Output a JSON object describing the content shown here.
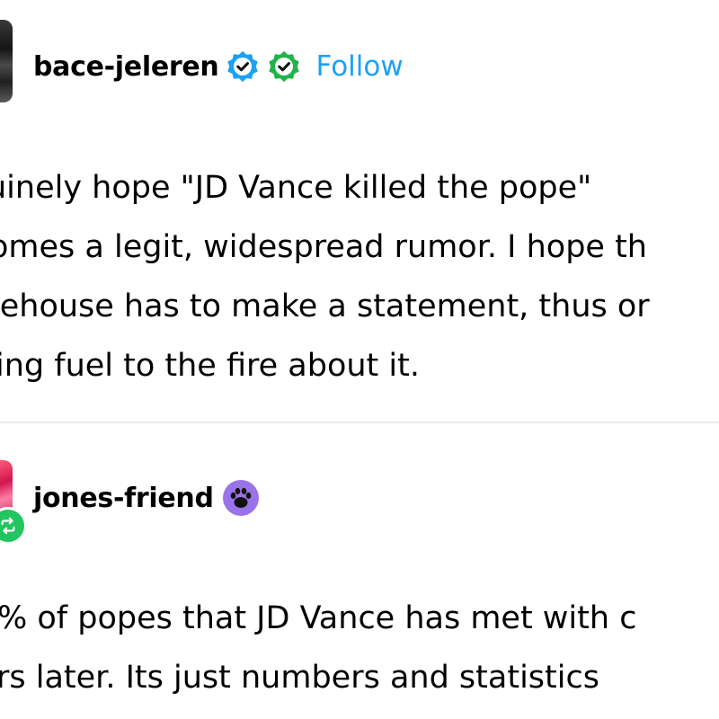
{
  "post": {
    "author": "bace-jeleren",
    "follow_label": "Follow",
    "verified_badges": [
      "blue-verified-badge",
      "green-verified-badge"
    ],
    "body_lines": [
      "uinely hope \"JD Vance killed the pope\"",
      "omes a legit, widespread rumor. I hope th",
      "tehouse has to make a statement, thus or",
      "ing fuel to the fire about it."
    ]
  },
  "reply": {
    "author": "jones-friend",
    "badge_icon": "paw-badge",
    "reblog_icon": "reblog-icon",
    "body_lines": [
      "% of popes that JD Vance has met with c",
      "rs later. Its just numbers and statistics"
    ]
  },
  "colors": {
    "follow": "#1da1f2",
    "blue_badge": "#1da1f2",
    "green_badge": "#20b34a",
    "reblog": "#22c55e",
    "paw_badge": "#9b73e8",
    "divider": "#ebebeb"
  }
}
